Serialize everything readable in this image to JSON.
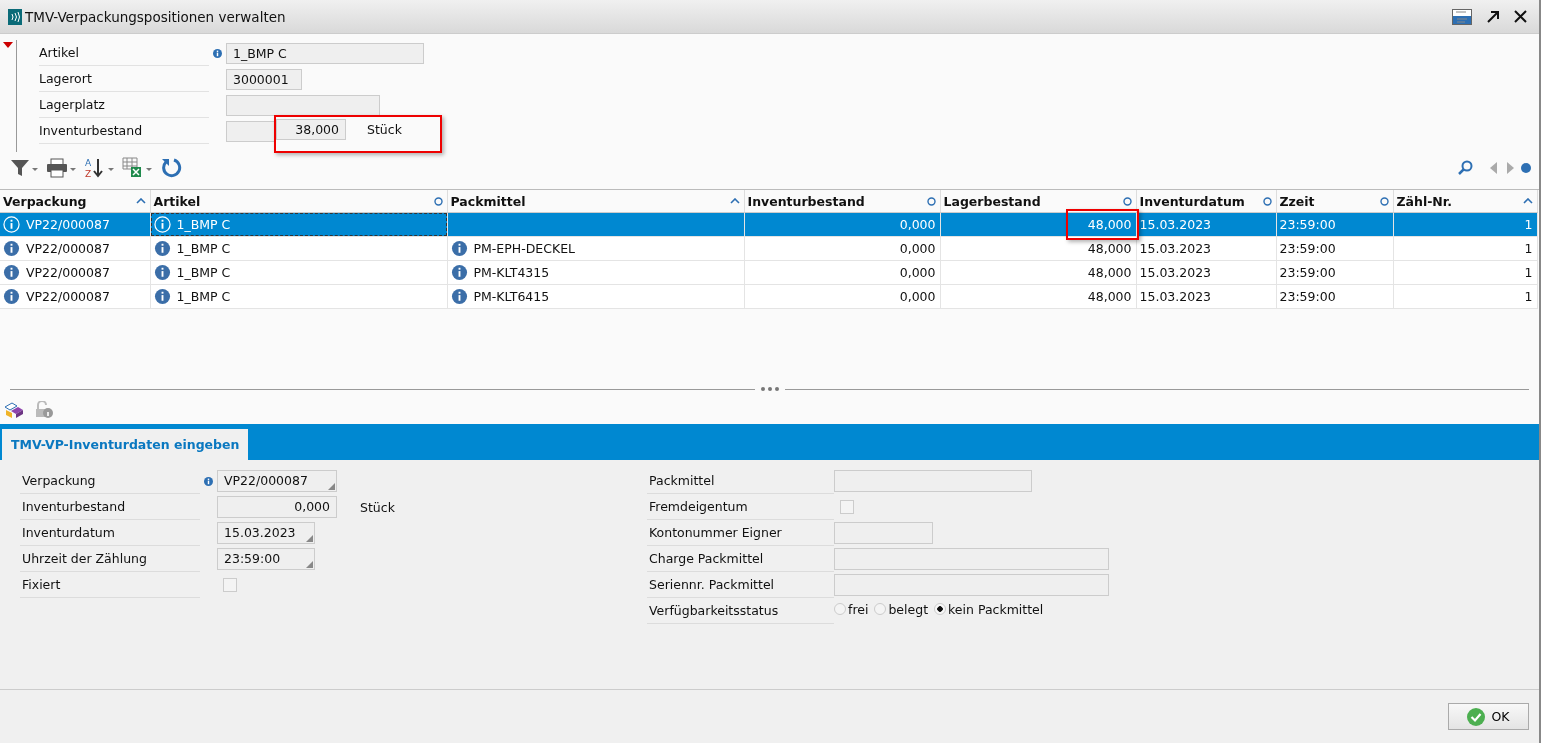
{
  "window": {
    "title": "TMV-Verpackungspositionen verwalten"
  },
  "header": {
    "expanded": true,
    "fields": [
      {
        "label": "Artikel",
        "info": true,
        "value": "1_BMP C"
      },
      {
        "label": "Lagerort",
        "info": false,
        "value": "3000001"
      },
      {
        "label": "Lagerplatz",
        "info": false
      },
      {
        "label": "Inventurbestand",
        "info": false,
        "value": "38,000",
        "unit": "Stück",
        "marked": true
      }
    ]
  },
  "table": {
    "columns": [
      {
        "label": "Verpackung",
        "sorted_ascending": true
      },
      {
        "label": "Artikel",
        "sorted_ascending": false
      },
      {
        "label": "Packmittel",
        "sorted_ascending": true
      },
      {
        "label": "Inventurbestand",
        "sorted_ascending": false
      },
      {
        "label": "Lagerbestand",
        "sorted_ascending": false
      },
      {
        "label": "Inventurdatum",
        "sorted_ascending": false
      },
      {
        "label": "Zzeit",
        "sorted_ascending": false
      },
      {
        "label": "Zähl-Nr.",
        "sorted_ascending": true
      }
    ],
    "rows": [
      {
        "selected": true,
        "marked": true,
        "cells": [
          "VP22/000087",
          "1_BMP C",
          "",
          "0,000",
          "48,000",
          "15.03.2023",
          "23:59:00",
          "1"
        ]
      },
      {
        "selected": false,
        "marked": false,
        "cells": [
          "VP22/000087",
          "1_BMP C",
          "PM-EPH-DECKEL",
          "0,000",
          "48,000",
          "15.03.2023",
          "23:59:00",
          "1"
        ]
      },
      {
        "selected": false,
        "marked": false,
        "cells": [
          "VP22/000087",
          "1_BMP C",
          "PM-KLT4315",
          "0,000",
          "48,000",
          "15.03.2023",
          "23:59:00",
          "1"
        ]
      },
      {
        "selected": false,
        "marked": false,
        "cells": [
          "VP22/000087",
          "1_BMP C",
          "PM-KLT6415",
          "0,000",
          "48,000",
          "15.03.2023",
          "23:59:00",
          "1"
        ]
      }
    ]
  },
  "toolbar": {
    "sort_letters": [
      "A",
      "Z"
    ]
  },
  "tabs": [
    {
      "label": "TMV-VP-Inventurdaten eingeben",
      "selected": true
    }
  ],
  "form_left": [
    {
      "kind": "dropdown",
      "label": "Verpackung",
      "info": true,
      "value": "VP22/000087"
    },
    {
      "kind": "number",
      "label": "Inventurbestand",
      "info": false,
      "value": "0,000",
      "unit": "Stück"
    },
    {
      "kind": "dropdown",
      "label": "Inventurdatum",
      "info": false,
      "value": "15.03.2023"
    },
    {
      "kind": "dropdown",
      "label": "Uhrzeit der Zählung",
      "info": false,
      "value": "23:59:00"
    },
    {
      "kind": "checkbox",
      "label": "Fixiert",
      "checked": false
    }
  ],
  "form_right": [
    {
      "kind": "text",
      "label": "Packmittel"
    },
    {
      "kind": "checkbox",
      "label": "Fremdeigentum",
      "checked": false
    },
    {
      "kind": "text",
      "label": "Kontonummer Eigner"
    },
    {
      "kind": "text",
      "label": "Charge Packmittel"
    },
    {
      "kind": "text",
      "label": "Seriennr. Packmittel"
    },
    {
      "kind": "radio",
      "label": "Verfügbarkeitsstatus",
      "options": [
        {
          "label": "frei",
          "selected": false
        },
        {
          "label": "belegt",
          "selected": false
        },
        {
          "label": "kein Packmittel",
          "selected": true
        }
      ]
    }
  ],
  "buttons": [
    {
      "label": "OK"
    }
  ]
}
